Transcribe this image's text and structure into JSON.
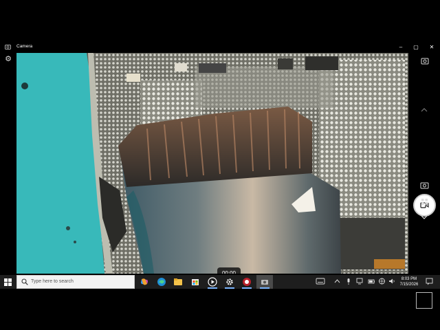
{
  "window": {
    "title": "Camera",
    "controls": {
      "minimize": "–",
      "maximize": "▢",
      "close": "✕"
    }
  },
  "camera": {
    "timer": "00:00",
    "mode": "video",
    "icons": [
      "settings-icon",
      "photo-mode-icon",
      "chevron-up-icon",
      "video-mode-icon",
      "camera-icon",
      "barcode-icon",
      "chevron-down-icon"
    ]
  },
  "taskbar": {
    "search_placeholder": "Type here to search",
    "apps": [
      "copilot-icon",
      "edge-icon",
      "file-explorer-icon",
      "microsoft-store-icon",
      "media-player-icon",
      "settings-icon",
      "screen-recorder-icon",
      "camera-app-icon"
    ],
    "tray_icons": [
      "keyboard-icon",
      "chevron-up-icon",
      "microphone-icon",
      "network-icon",
      "battery-icon",
      "wifi-icon",
      "volume-icon",
      "notification-icon"
    ],
    "time": "8:03 PM",
    "date": "7/15/2026"
  },
  "colors": {
    "accent": "#7ab4ff",
    "taskbar_bg": "#1e1e1e",
    "window_bg": "#000000"
  }
}
